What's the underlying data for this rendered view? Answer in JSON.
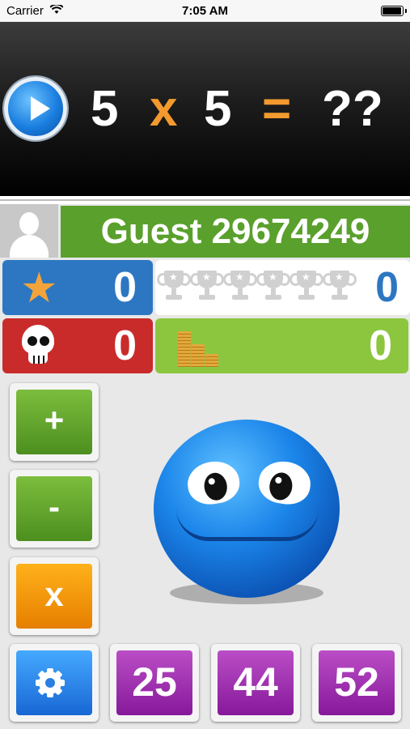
{
  "status_bar": {
    "carrier": "Carrier",
    "time": "7:05 AM",
    "battery_level": 1.0
  },
  "question": {
    "operand_a": "5",
    "operator": "x",
    "operand_b": "5",
    "equals": "=",
    "answer": "??"
  },
  "player": {
    "name": "Guest 29674249"
  },
  "stats": {
    "stars": "0",
    "trophies": "0",
    "deaths": "0",
    "coins": "0",
    "trophy_slots": 6
  },
  "operations": {
    "add": "+",
    "subtract": "-",
    "multiply": "x"
  },
  "answers": [
    "25",
    "44",
    "52"
  ],
  "colors": {
    "green": "#5aa02c",
    "blue": "#2d77c2",
    "red": "#c92b2b",
    "orange": "#f39a2e",
    "purple": "#a233b3"
  }
}
